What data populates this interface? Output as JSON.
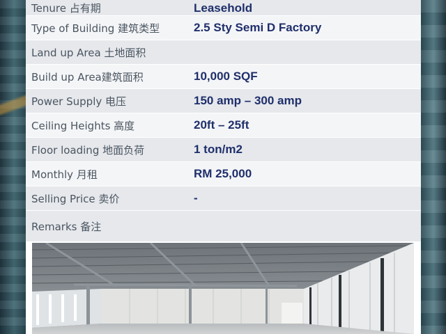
{
  "rows": [
    {
      "label": "Tenure 占有期",
      "value": "Leasehold"
    },
    {
      "label": "Type of Building 建筑类型",
      "value": "2.5 Sty Semi D Factory"
    },
    {
      "label": "Land up Area 土地面积",
      "value": ""
    },
    {
      "label": "Build up Area建筑面积",
      "value": "10,000 SQF"
    },
    {
      "label": "Power Supply 电压",
      "value": "150 amp – 300 amp"
    },
    {
      "label": "Ceiling Heights 高度",
      "value": "20ft – 25ft"
    },
    {
      "label": "Floor loading 地面负荷",
      "value": "1 ton/m2"
    },
    {
      "label": "Monthly 月租",
      "value": "RM 25,000"
    },
    {
      "label": "Selling Price 卖价",
      "value": "-"
    }
  ],
  "remarks": {
    "label": "Remarks 备注",
    "value": ""
  },
  "colors": {
    "value_text": "#1f2f6b",
    "label_text": "#4a5560",
    "row_dark": "#e6e8ec",
    "row_light": "#f4f5f7"
  }
}
